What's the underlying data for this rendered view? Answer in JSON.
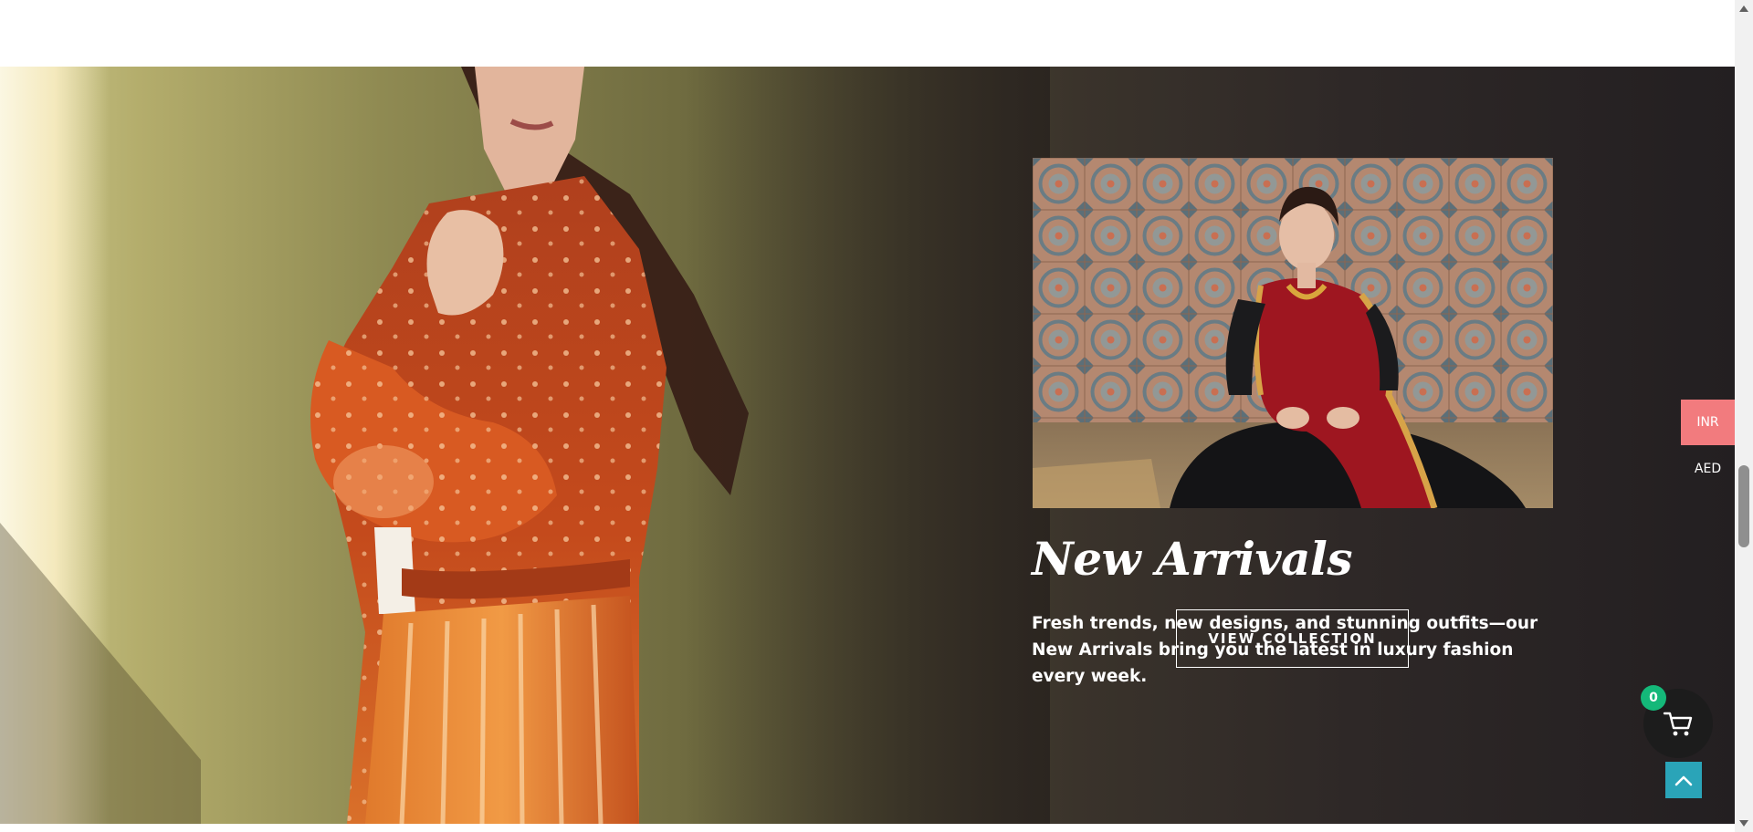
{
  "hero": {
    "title": "New Arrivals",
    "description": "Fresh trends, new designs, and stunning outfits—our New Arrivals bring you the latest in luxury fashion every week.",
    "cta_label": "VIEW COLLECTION",
    "background_photo": "woman in orange printed dress",
    "feature_photo": "woman in red saree against tiled wall"
  },
  "currency_switcher": {
    "options": [
      "INR",
      "AED"
    ],
    "selected": "INR"
  },
  "cart": {
    "count": "0",
    "icon": "cart-icon"
  },
  "back_to_top": {
    "icon": "chevron-up-icon"
  },
  "colors": {
    "currency_active": "#f27b7e",
    "cart_badge": "#14b879",
    "back_to_top": "#2aa4b8",
    "hero_dark": "#231f21"
  }
}
